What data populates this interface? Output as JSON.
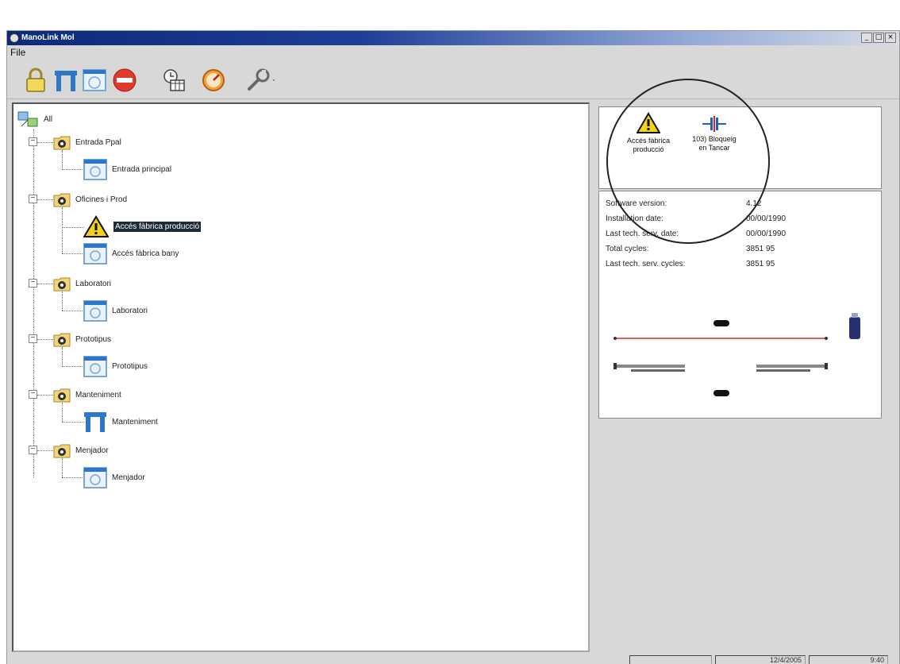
{
  "window": {
    "title_prefix": "ManoLink",
    "title_app": "Mol",
    "buttons": {
      "minimize": "_",
      "maximize": "□",
      "close": "×"
    }
  },
  "menu": {
    "file": "File"
  },
  "toolbar": {
    "icons": [
      "lock-icon",
      "gate-icon",
      "station-icon",
      "stop-icon",
      "schedule-icon",
      "gauge-icon",
      "wrench-icon"
    ],
    "dropdown_arrow": "·"
  },
  "tree": {
    "root": "All",
    "groups": [
      {
        "label": "Entrada Ppal",
        "children": [
          {
            "label": "Entrada principal",
            "icon": "station-icon"
          }
        ]
      },
      {
        "label": "Oficines i Prod",
        "children": [
          {
            "label": "Accés fàbrica producció",
            "icon": "warning-icon",
            "selected": true
          },
          {
            "label": "Accés fàbrica bany",
            "icon": "station-icon"
          }
        ]
      },
      {
        "label": "Laboratori",
        "children": [
          {
            "label": "Laboratori",
            "icon": "station-icon"
          }
        ]
      },
      {
        "label": "Prototipus",
        "children": [
          {
            "label": "Prototipus",
            "icon": "station-icon"
          }
        ]
      },
      {
        "label": "Manteniment",
        "children": [
          {
            "label": "Manteniment",
            "icon": "gate-icon"
          }
        ]
      },
      {
        "label": "Menjador",
        "children": [
          {
            "label": "Menjador",
            "icon": "station-icon"
          }
        ]
      }
    ]
  },
  "alarms": [
    {
      "line1": "Accés fàbrica",
      "line2": "producció",
      "icon": "warning-icon"
    },
    {
      "line1": "103) Bloqueig",
      "line2": "en Tancar",
      "icon": "blocked-door-icon"
    }
  ],
  "info": {
    "rows": [
      {
        "label": "Software version:",
        "value": "4.12"
      },
      {
        "label": "Installation date:",
        "value": "00/00/1990"
      },
      {
        "label": "Last tech. serv. date:",
        "value": "00/00/1990"
      },
      {
        "label": "Total cycles:",
        "value": "3851 95"
      },
      {
        "label": "Last tech. serv. cycles:",
        "value": "3851 95"
      }
    ]
  },
  "status": {
    "date": "12/4/2005",
    "time": "9:40"
  },
  "colors": {
    "title_dark": "#0b2a7a",
    "selection": "#1c2a38",
    "beam": "#e06060",
    "accent_blue": "#1e5fb8"
  }
}
